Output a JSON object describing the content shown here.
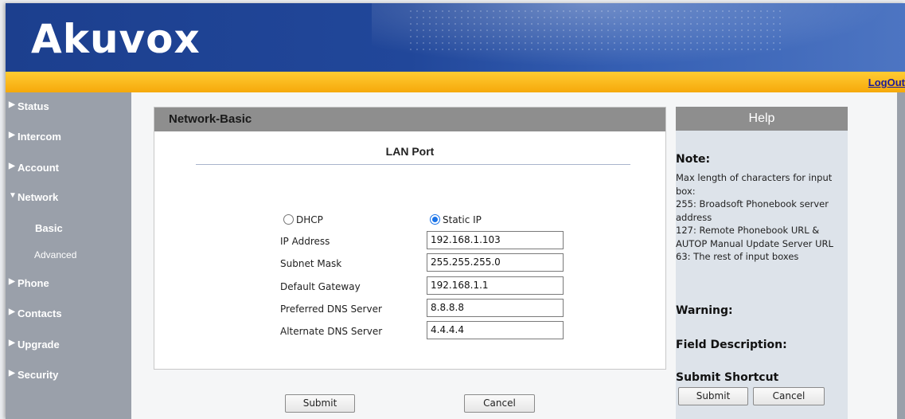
{
  "brand": {
    "logo_text": "Akuvox"
  },
  "topbar": {
    "logout_label": "LogOut"
  },
  "sidebar": {
    "items": [
      {
        "label": "Status",
        "arrow": "▶"
      },
      {
        "label": "Intercom",
        "arrow": "▶"
      },
      {
        "label": "Account",
        "arrow": "▶"
      },
      {
        "label": "Network",
        "arrow": "▼"
      },
      {
        "label": "Phone",
        "arrow": "▶"
      },
      {
        "label": "Contacts",
        "arrow": "▶"
      },
      {
        "label": "Upgrade",
        "arrow": "▶"
      },
      {
        "label": "Security",
        "arrow": "▶"
      }
    ],
    "subitems": [
      {
        "label": "Basic",
        "active": true
      },
      {
        "label": "Advanced",
        "active": false
      }
    ]
  },
  "panel": {
    "title": "Network-Basic",
    "section": "LAN Port",
    "mode_options": [
      {
        "label": "DHCP",
        "checked": false
      },
      {
        "label": "Static IP",
        "checked": true
      }
    ],
    "fields": [
      {
        "label": "IP Address",
        "value": "192.168.1.103"
      },
      {
        "label": "Subnet Mask",
        "value": "255.255.255.0"
      },
      {
        "label": "Default Gateway",
        "value": "192.168.1.1"
      },
      {
        "label": "Preferred DNS Server",
        "value": "8.8.8.8"
      },
      {
        "label": "Alternate DNS Server",
        "value": "4.4.4.4"
      }
    ],
    "submit_label": "Submit",
    "cancel_label": "Cancel"
  },
  "help": {
    "title": "Help",
    "note_heading": "Note:",
    "note_lines": [
      "Max length of characters for input",
      "box:",
      "255: Broadsoft Phonebook server",
      "address",
      "127: Remote Phonebook URL &",
      "AUTOP Manual Update Server URL",
      "63: The rest of input boxes"
    ],
    "warning_heading": "Warning:",
    "field_desc_heading": "Field Description:",
    "shortcut_heading": "Submit Shortcut",
    "submit_label": "Submit",
    "cancel_label": "Cancel"
  },
  "colors": {
    "header_blue": "#21479a",
    "accent_orange": "#f6a90b",
    "sidebar_gray": "#9aa0aa",
    "panel_header_gray": "#8e8e8e",
    "radio_blue": "#1a73e8"
  }
}
